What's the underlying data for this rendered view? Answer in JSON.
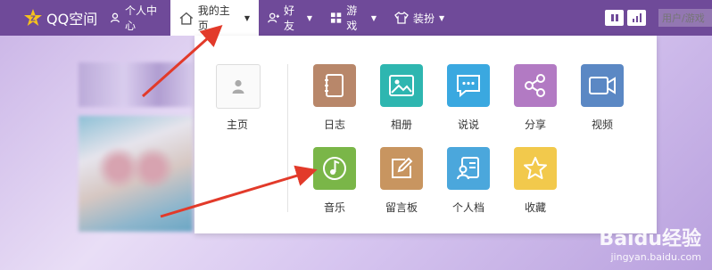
{
  "nav": {
    "logo_text": "QQ空间",
    "items": [
      {
        "label": "个人中心",
        "icon": "person-icon"
      },
      {
        "label": "我的主页",
        "icon": "home-icon",
        "active": true
      },
      {
        "label": "好友",
        "icon": "friends-icon"
      },
      {
        "label": "游戏",
        "icon": "grid-icon"
      },
      {
        "label": "装扮",
        "icon": "shirt-icon"
      }
    ],
    "search_placeholder": "用户/游戏"
  },
  "dropdown": {
    "home_label": "主页",
    "apps": [
      {
        "label": "日志",
        "icon": "diary-icon",
        "color": "#b8876a"
      },
      {
        "label": "相册",
        "icon": "photo-icon",
        "color": "#2eb6b0"
      },
      {
        "label": "说说",
        "icon": "chat-icon",
        "color": "#3aa8e0"
      },
      {
        "label": "分享",
        "icon": "share-icon",
        "color": "#b27ac3"
      },
      {
        "label": "视频",
        "icon": "video-icon",
        "color": "#5b88c4"
      },
      {
        "label": "音乐",
        "icon": "music-icon",
        "color": "#7ab648"
      },
      {
        "label": "留言板",
        "icon": "message-board-icon",
        "color": "#c89560"
      },
      {
        "label": "个人档",
        "icon": "profile-card-icon",
        "color": "#4ba7dc"
      },
      {
        "label": "收藏",
        "icon": "star-icon",
        "color": "#f2c94c"
      }
    ]
  },
  "watermark": {
    "main": "Baidu经验",
    "sub": "jingyan.baidu.com"
  },
  "colors": {
    "nav_bg": "#6f4a99",
    "arrow": "#e23a2a"
  }
}
